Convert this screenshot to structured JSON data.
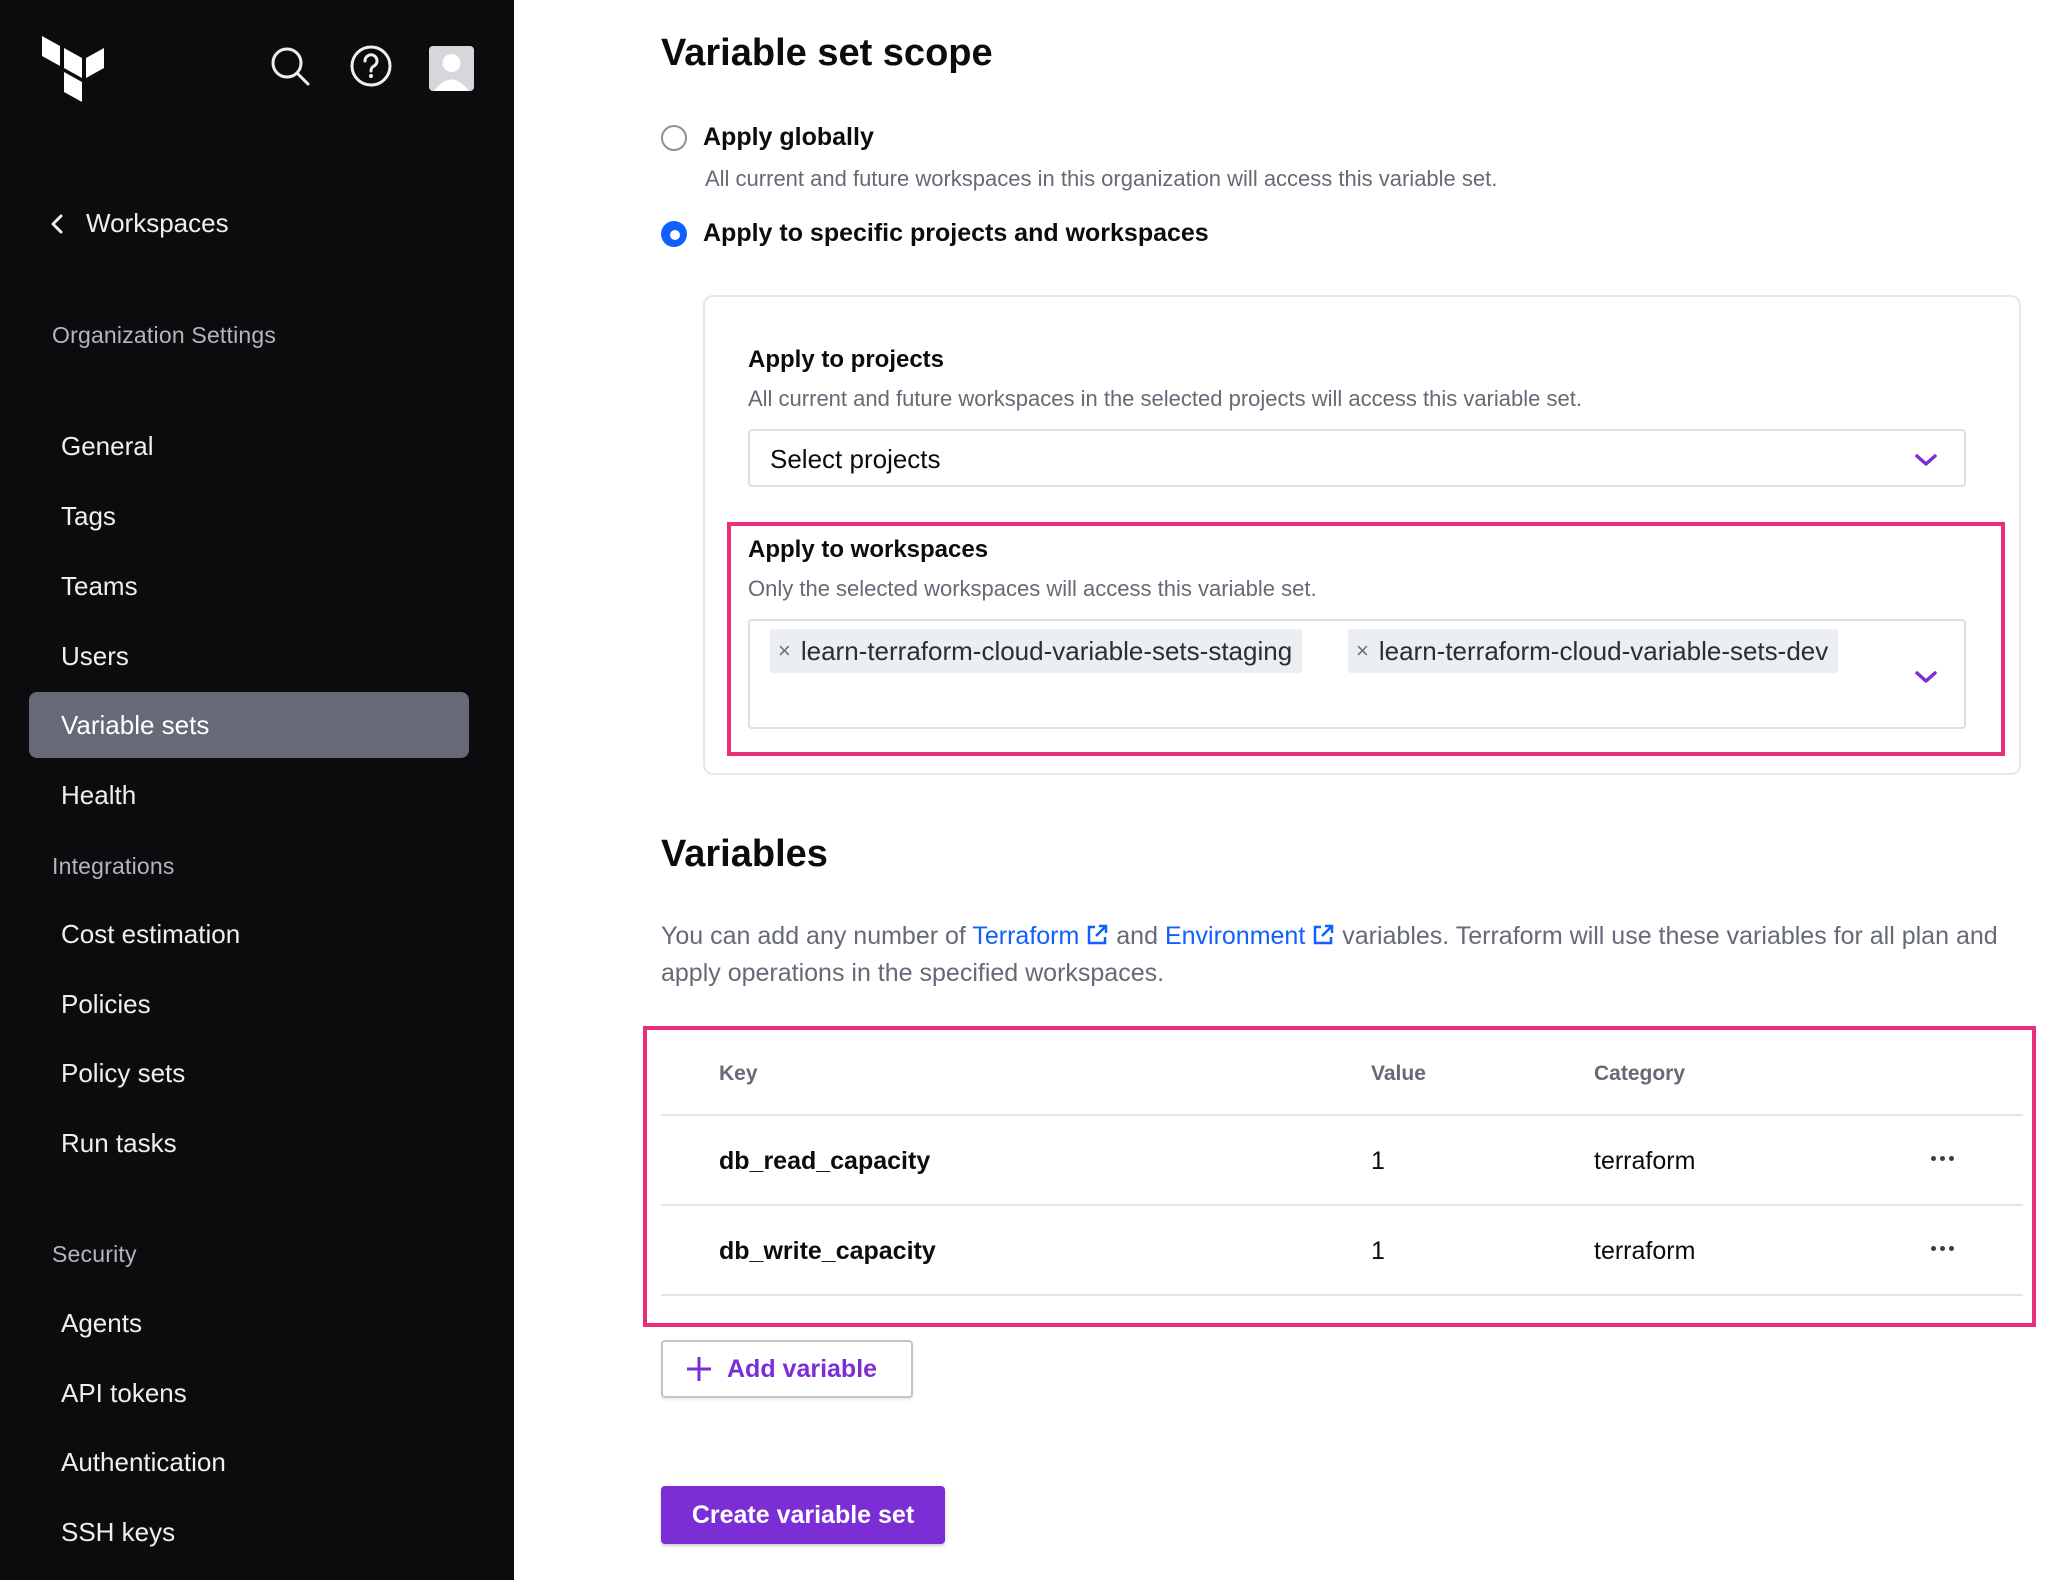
{
  "sidebar": {
    "back_link": "Workspaces",
    "org_heading": "Organization Settings",
    "items": [
      {
        "label": "General"
      },
      {
        "label": "Tags"
      },
      {
        "label": "Teams"
      },
      {
        "label": "Users"
      },
      {
        "label": "Variable sets",
        "active": true
      },
      {
        "label": "Health"
      }
    ],
    "integrations_heading": "Integrations",
    "integration_items": [
      {
        "label": "Cost estimation"
      },
      {
        "label": "Policies"
      },
      {
        "label": "Policy sets"
      },
      {
        "label": "Run tasks"
      }
    ],
    "security_heading": "Security",
    "security_items": [
      {
        "label": "Agents"
      },
      {
        "label": "API tokens"
      },
      {
        "label": "Authentication"
      },
      {
        "label": "SSH keys"
      }
    ]
  },
  "scope": {
    "title": "Variable set scope",
    "global_label": "Apply globally",
    "global_help": "All current and future workspaces in this organization will access this variable set.",
    "specific_label": "Apply to specific projects and workspaces",
    "selected": "specific",
    "projects_label": "Apply to projects",
    "projects_help": "All current and future workspaces in the selected projects will access this variable set.",
    "projects_placeholder": "Select projects",
    "workspaces_label": "Apply to workspaces",
    "workspaces_help": "Only the selected workspaces will access this variable set.",
    "workspaces": [
      "learn-terraform-cloud-variable-sets-staging",
      "learn-terraform-cloud-variable-sets-dev"
    ],
    "chip_remove_glyph": "×"
  },
  "variables": {
    "title": "Variables",
    "desc_prefix": "You can add any number of ",
    "terraform_link": "Terraform",
    "desc_mid": " and ",
    "environment_link": "Environment",
    "desc_suffix": " variables. Terraform will use these variables for all plan and apply operations in the specified workspaces.",
    "columns": {
      "key": "Key",
      "value": "Value",
      "category": "Category"
    },
    "rows": [
      {
        "key": "db_read_capacity",
        "value": "1",
        "category": "terraform"
      },
      {
        "key": "db_write_capacity",
        "value": "1",
        "category": "terraform"
      }
    ],
    "add_button": "Add variable"
  },
  "create_button": "Create variable set",
  "colors": {
    "accent_purple": "#7b2ed6",
    "link_blue": "#1060ff",
    "highlight_pink": "#e8307a",
    "sidebar_bg": "#0c0c0e"
  }
}
